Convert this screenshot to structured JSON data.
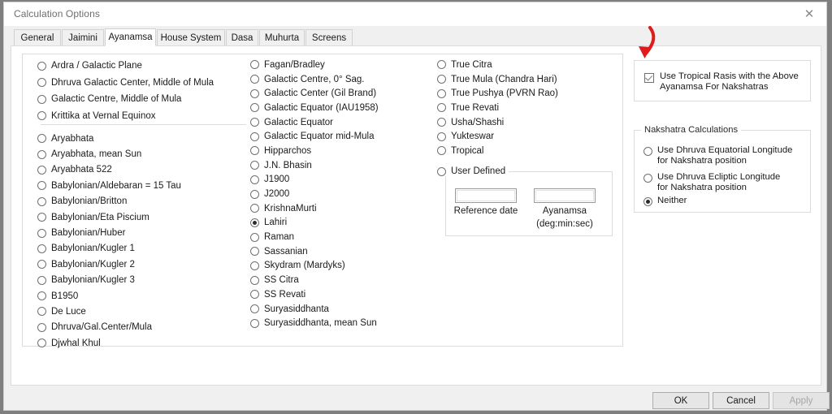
{
  "window": {
    "title": "Calculation Options",
    "close_icon": "close-icon"
  },
  "tabs": [
    {
      "label": "General",
      "active": false
    },
    {
      "label": "Jaimini",
      "active": false
    },
    {
      "label": "Ayanamsa",
      "active": true
    },
    {
      "label": "House System",
      "active": false
    },
    {
      "label": "Dasa",
      "active": false
    },
    {
      "label": "Muhurta",
      "active": false
    },
    {
      "label": "Screens",
      "active": false
    }
  ],
  "ayanamsa": {
    "column1_top": [
      {
        "label": "Ardra / Galactic Plane",
        "selected": false
      },
      {
        "label": "Dhruva Galactic Center, Middle of Mula",
        "selected": false
      },
      {
        "label": "Galactic Centre, Middle of Mula",
        "selected": false
      },
      {
        "label": "Krittika at Vernal Equinox",
        "selected": false
      }
    ],
    "column1_bottom": [
      {
        "label": "Aryabhata",
        "selected": false
      },
      {
        "label": "Aryabhata, mean Sun",
        "selected": false
      },
      {
        "label": "Aryabhata 522",
        "selected": false
      },
      {
        "label": "Babylonian/Aldebaran = 15 Tau",
        "selected": false
      },
      {
        "label": "Babylonian/Britton",
        "selected": false
      },
      {
        "label": "Babylonian/Eta Piscium",
        "selected": false
      },
      {
        "label": "Babylonian/Huber",
        "selected": false
      },
      {
        "label": "Babylonian/Kugler 1",
        "selected": false
      },
      {
        "label": "Babylonian/Kugler 2",
        "selected": false
      },
      {
        "label": "Babylonian/Kugler 3",
        "selected": false
      },
      {
        "label": "B1950",
        "selected": false
      },
      {
        "label": "De Luce",
        "selected": false
      },
      {
        "label": "Dhruva/Gal.Center/Mula",
        "selected": false
      },
      {
        "label": "Djwhal Khul",
        "selected": false
      }
    ],
    "column2": [
      {
        "label": "Fagan/Bradley",
        "selected": false
      },
      {
        "label": "Galactic Centre, 0° Sag.",
        "selected": false
      },
      {
        "label": "Galactic Center (Gil Brand)",
        "selected": false
      },
      {
        "label": "Galactic Equator (IAU1958)",
        "selected": false
      },
      {
        "label": "Galactic Equator",
        "selected": false
      },
      {
        "label": "Galactic Equator mid-Mula",
        "selected": false
      },
      {
        "label": "Hipparchos",
        "selected": false
      },
      {
        "label": "J.N. Bhasin",
        "selected": false
      },
      {
        "label": "J1900",
        "selected": false
      },
      {
        "label": "J2000",
        "selected": false
      },
      {
        "label": "KrishnaMurti",
        "selected": false
      },
      {
        "label": "Lahiri",
        "selected": true
      },
      {
        "label": "Raman",
        "selected": false
      },
      {
        "label": "Sassanian",
        "selected": false
      },
      {
        "label": "Skydram (Mardyks)",
        "selected": false
      },
      {
        "label": "SS Citra",
        "selected": false
      },
      {
        "label": "SS Revati",
        "selected": false
      },
      {
        "label": "Suryasiddhanta",
        "selected": false
      },
      {
        "label": "Suryasiddhanta, mean Sun",
        "selected": false
      }
    ],
    "column3": [
      {
        "label": "True Citra",
        "selected": false
      },
      {
        "label": "True Mula (Chandra Hari)",
        "selected": false
      },
      {
        "label": "True Pushya (PVRN Rao)",
        "selected": false
      },
      {
        "label": "True Revati",
        "selected": false
      },
      {
        "label": "Usha/Shashi",
        "selected": false
      },
      {
        "label": "Yukteswar",
        "selected": false
      },
      {
        "label": "Tropical",
        "selected": false
      }
    ],
    "user_defined": {
      "label": "User Defined",
      "selected": false,
      "reference_date": {
        "value": "",
        "label": "Reference date"
      },
      "ayanamsa": {
        "value": "",
        "label_line1": "Ayanamsa",
        "label_line2": "(deg:min:sec)"
      }
    }
  },
  "tropical_rasis": {
    "checked": true,
    "label_line1": "Use Tropical Rasis with the Above",
    "label_line2": "Ayanamsa For Nakshatras"
  },
  "nakshatra_calculations": {
    "caption": "Nakshatra Calculations",
    "options": [
      {
        "line1": "Use Dhruva Equatorial Longitude",
        "line2": "for Nakshatra position",
        "selected": false
      },
      {
        "line1": "Use Dhruva Ecliptic Longitude",
        "line2": "for Nakshatra position",
        "selected": false
      },
      {
        "line1": "Neither",
        "line2": "",
        "selected": true
      }
    ]
  },
  "footer": {
    "ok": "OK",
    "cancel": "Cancel",
    "apply": "Apply",
    "apply_disabled": true
  },
  "annotation": {
    "arrow_color": "#e01b1b",
    "points_to": "tropical-rasis-checkbox"
  }
}
